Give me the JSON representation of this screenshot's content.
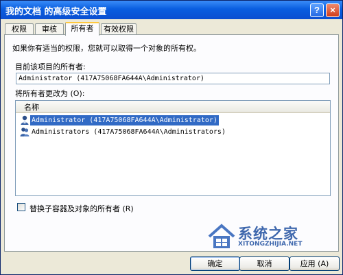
{
  "window": {
    "title": "我的文档  的高级安全设置",
    "help_label": "?",
    "close_label": "×"
  },
  "tabs": [
    {
      "label": "权限",
      "active": false
    },
    {
      "label": "审核",
      "active": false
    },
    {
      "label": "所有者",
      "active": true
    },
    {
      "label": "有效权限",
      "active": false
    }
  ],
  "panel": {
    "intro": "如果你有适当的权限，您就可以取得一个对象的所有权。",
    "current_owner_label": "目前该项目的所有者:",
    "current_owner_value": "Administrator (417A75068FA644A\\Administrator)",
    "change_owner_label": "将所有者更改为 (O):",
    "list_header": "名称",
    "owners": [
      {
        "name": "Administrator (417A75068FA644A\\Administrator)",
        "selected": true,
        "icon": "user-icon"
      },
      {
        "name": "Administrators (417A75068FA644A\\Administrators)",
        "selected": false,
        "icon": "group-icon"
      }
    ],
    "replace_checkbox_label": "替换子容器及对象的所有者 (R)",
    "replace_checked": false
  },
  "buttons": {
    "ok": "确定",
    "cancel": "取消",
    "apply": "应用 (A)"
  },
  "watermark": {
    "name": "系统之家",
    "url": "XITONGZHIJIA.NET"
  },
  "colors": {
    "titlebar": "#0a5ee0",
    "selection": "#316ac5",
    "tab_highlight": "#ffc83c",
    "dialog_bg": "#ece9d8"
  }
}
